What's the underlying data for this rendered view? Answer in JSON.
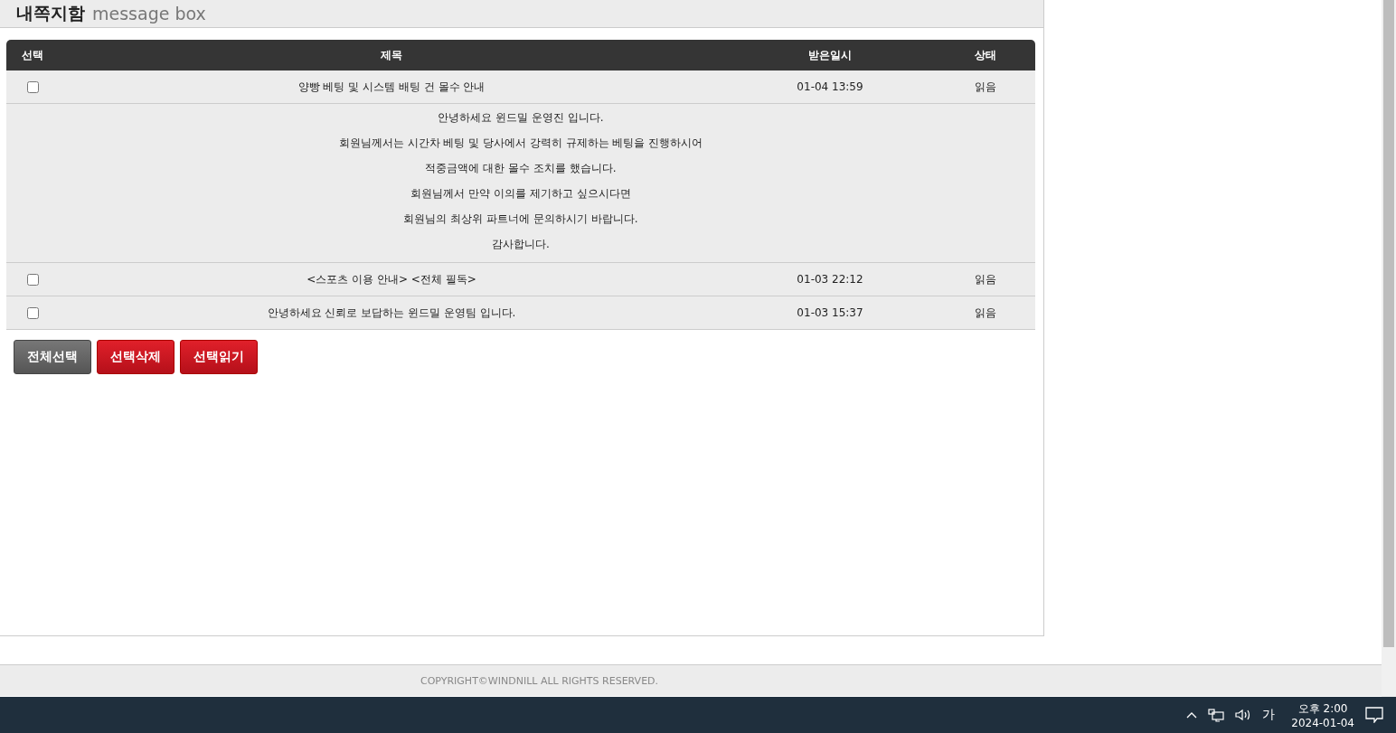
{
  "page_title": {
    "korean": "내쪽지함",
    "english": "message box"
  },
  "table": {
    "columns": [
      "선택",
      "제목",
      "받은일시",
      "상태"
    ],
    "rows": [
      {
        "checked": false,
        "title": "양빵 베팅 및 시스템 배팅 건 몰수 안내",
        "date": "01-04 13:59",
        "status": "읽음",
        "body": [
          "안녕하세요 윈드밀 운영진 입니다.",
          "회원님께서는 시간차 베팅 및 당사에서 강력히 규제하는 베팅을 진행하시어",
          "적중금액에 대한 몰수 조치를 했습니다.",
          "회원님께서 만약 이의를 제기하고 싶으시다면",
          "회원님의 최상위 파트너에 문의하시기 바랍니다.",
          "감사합니다."
        ]
      },
      {
        "checked": false,
        "title": "<스포츠 이용 안내> <전체 필독>",
        "date": "01-03 22:12",
        "status": "읽음"
      },
      {
        "checked": false,
        "title": "안녕하세요 신뢰로 보답하는 윈드밀 운영팀 입니다.",
        "date": "01-03 15:37",
        "status": "읽음"
      }
    ]
  },
  "buttons": [
    {
      "label": "전체선택",
      "kind": "gray"
    },
    {
      "label": "선택삭제",
      "kind": "red"
    },
    {
      "label": "선택읽기",
      "kind": "red"
    }
  ],
  "footer": "COPYRIGHT©WINDNILL ALL RIGHTS RESERVED.",
  "taskbar": {
    "ime": "가",
    "time": "오후 2:00",
    "date": "2024-01-04"
  }
}
